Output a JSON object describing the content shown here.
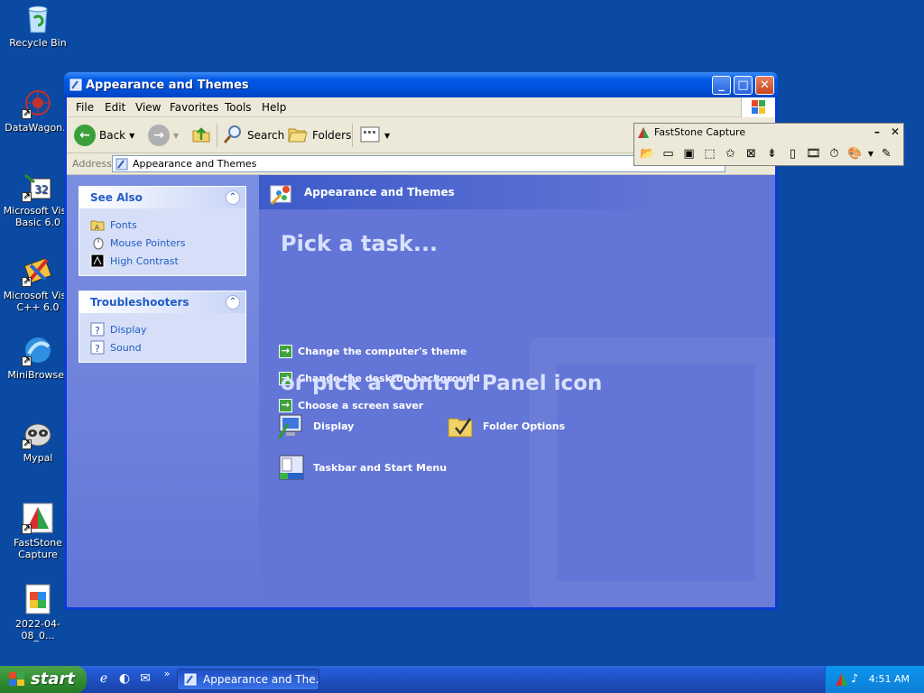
{
  "desktop": {
    "icons": [
      {
        "label": "Recycle Bin"
      },
      {
        "label": "DataWagon.c"
      },
      {
        "label": "Microsoft Visu\nBasic 6.0"
      },
      {
        "label": "Microsoft Visu\nC++ 6.0"
      },
      {
        "label": "MiniBrowser"
      },
      {
        "label": "Mypal"
      },
      {
        "label": "FastStone\nCapture"
      },
      {
        "label": "2022-04-08_0..."
      }
    ]
  },
  "window": {
    "title": "Appearance and Themes",
    "controls": {
      "minimize": "_",
      "maximize": "□",
      "close": "✕"
    },
    "menu": [
      "File",
      "Edit",
      "View",
      "Favorites",
      "Tools",
      "Help"
    ],
    "toolbar": {
      "back": "Back",
      "search": "Search",
      "folders": "Folders"
    },
    "address": {
      "label": "Address",
      "value": "Appearance and Themes"
    },
    "see_also": {
      "title": "See Also",
      "items": [
        "Fonts",
        "Mouse Pointers",
        "High Contrast"
      ]
    },
    "troubleshooters": {
      "title": "Troubleshooters",
      "items": [
        "Display",
        "Sound"
      ]
    },
    "main": {
      "header": "Appearance and Themes",
      "pick_task": "Pick a task...",
      "tasks": [
        "Change the computer's theme",
        "Change the desktop background",
        "Choose a screen saver"
      ],
      "or_pick": "or pick a Control Panel icon",
      "icons": [
        "Display",
        "Folder Options",
        "Taskbar and Start Menu"
      ]
    }
  },
  "faststone": {
    "title": "FastStone Capture"
  },
  "taskbar": {
    "start": "start",
    "task": "Appearance and The...",
    "clock": "4:51 AM",
    "chevron": "»"
  },
  "colors": {
    "desktop": "#0a4aa2",
    "content": "#6375d6",
    "link": "#215dc6"
  }
}
